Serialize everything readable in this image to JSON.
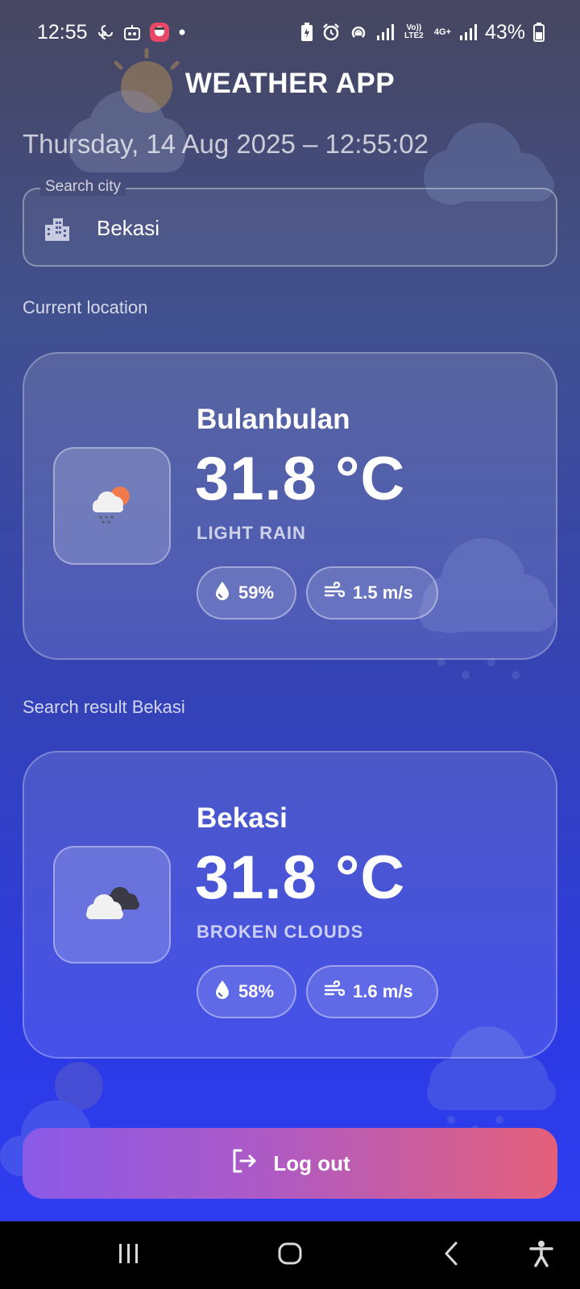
{
  "status_bar": {
    "time": "12:55",
    "battery": "43%",
    "icons": [
      "pinwheel-icon",
      "robot-icon",
      "app-notification-icon",
      "dot-icon",
      "battery-saver-icon",
      "alarm-icon",
      "hotspot-icon",
      "signal-icon",
      "volte-icon",
      "4g-icon",
      "signal-icon",
      "battery-icon"
    ],
    "volte_label": "Vo)) LTE2",
    "network_label": "4G+"
  },
  "app": {
    "title": "WEATHER APP",
    "datetime": "Thursday, 14 Aug 2025 – 12:55:02"
  },
  "search": {
    "label": "Search city",
    "value": "Bekasi",
    "icon": "city-building-icon"
  },
  "current_section": {
    "label": "Current location"
  },
  "current_card": {
    "city": "Bulanbulan",
    "temperature": "31.8 °C",
    "condition": "LIGHT RAIN",
    "icon": "rain-cloud-sun-icon",
    "humidity": "59%",
    "wind": "1.5 m/s"
  },
  "result_section": {
    "label": "Search result  Bekasi"
  },
  "result_card": {
    "city": "Bekasi",
    "temperature": "31.8 °C",
    "condition": "BROKEN CLOUDS",
    "icon": "broken-clouds-icon",
    "humidity": "58%",
    "wind": "1.6 m/s"
  },
  "logout": {
    "label": "Log out",
    "icon": "logout-icon"
  },
  "nav_bar": {
    "items": [
      "recent-apps-icon",
      "home-icon",
      "back-icon",
      "accessibility-icon"
    ]
  },
  "colors": {
    "logout_gradient_start": "#8a5ae8",
    "logout_gradient_end": "#e4607a",
    "sun": "#f3a64a",
    "background_top": "#46465f",
    "background_bottom": "#2e3df0"
  }
}
